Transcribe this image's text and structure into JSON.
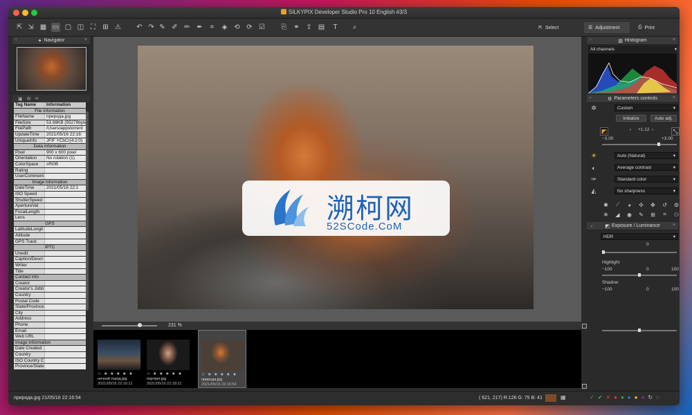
{
  "window": {
    "title": "SILKYPIX Developer Studio Pro 10 English   #3/3",
    "traffic_colors": [
      "#ff5f57",
      "#febc2e",
      "#28c840"
    ]
  },
  "toolbar": {
    "select_label": "Select",
    "adjustment_label": "Adjustment",
    "print_label": "Print"
  },
  "navigator": {
    "title": "Navigator"
  },
  "info": {
    "tag_header": "Tag Name",
    "info_header": "Information",
    "rows": [
      {
        "type": "section",
        "k": "File information"
      },
      {
        "k": "FileName",
        "v": "природа.jpg"
      },
      {
        "k": "FileSize",
        "v": "53.98KB (55279byte"
      },
      {
        "k": "FilePath",
        "v": "/Users/appstorrent"
      },
      {
        "k": "UpdateTime",
        "v": "2021/05/16 22:16:"
      },
      {
        "k": "UniqueInfo",
        "v": "JFIF YCbCr(4:2:0)"
      },
      {
        "type": "section",
        "k": "Data information"
      },
      {
        "k": "Pixel",
        "v": "900 x 600 pixel"
      },
      {
        "k": "Orientation",
        "v": "No rotation (1)"
      },
      {
        "k": "ColorSpace",
        "v": "sRGB"
      },
      {
        "k": "Rating",
        "v": ""
      },
      {
        "k": "UserComment",
        "v": ""
      },
      {
        "type": "section",
        "k": "Image information"
      },
      {
        "k": "DateTime",
        "v": "2021/05/16 22:1"
      },
      {
        "k": "ISO Speed",
        "v": ""
      },
      {
        "k": "ShutterSpeed",
        "v": ""
      },
      {
        "k": "ApertureVal",
        "v": ""
      },
      {
        "k": "FocalLength",
        "v": ""
      },
      {
        "k": "Lens",
        "v": ""
      },
      {
        "type": "section",
        "k": "GPS"
      },
      {
        "k": "LatitudeLongit",
        "v": ""
      },
      {
        "k": "Altitude",
        "v": ""
      },
      {
        "k": "GPS Track",
        "v": ""
      },
      {
        "type": "section",
        "k": "IPTC"
      },
      {
        "k": "Unedit",
        "v": ""
      },
      {
        "k": "Caption/Descr",
        "v": ""
      },
      {
        "k": "Writer",
        "v": ""
      },
      {
        "k": "Title",
        "v": ""
      },
      {
        "type": "section2",
        "k": "Contact info"
      },
      {
        "k": "Creator",
        "v": ""
      },
      {
        "k": "Creator's Jobti",
        "v": ""
      },
      {
        "k": "Country",
        "v": ""
      },
      {
        "k": "Postal Code",
        "v": ""
      },
      {
        "k": "State/Province",
        "v": ""
      },
      {
        "k": "City",
        "v": ""
      },
      {
        "k": "Address",
        "v": ""
      },
      {
        "k": "Phone",
        "v": ""
      },
      {
        "k": "Email",
        "v": ""
      },
      {
        "k": "Web URL",
        "v": ""
      },
      {
        "type": "section2",
        "k": "Image information"
      },
      {
        "k": "Date Created",
        "v": ""
      },
      {
        "k": "Country",
        "v": ""
      },
      {
        "k": "ISO Country C",
        "v": ""
      },
      {
        "k": "Province/State",
        "v": ""
      }
    ]
  },
  "watermark": {
    "cn": "溯柯网",
    "en": "52SCode.CoM"
  },
  "zoom": {
    "label": "231 %"
  },
  "filmstrip": [
    {
      "stars": "☆ ★ ★ ★ ★ ★",
      "name": "ночной город.jpg",
      "date": "2021/05/16 22:16:12"
    },
    {
      "stars": "☆ ★ ★ ★ ★ ★",
      "name": "портрет.jpg",
      "date": "2021/05/16 22:18:21"
    },
    {
      "stars": "☆ ★ ★ ★ ★ ★",
      "name": "природа.jpg",
      "date": "2021/05/16 22:16:54"
    }
  ],
  "histogram": {
    "title": "Histogram",
    "channel": "All channels"
  },
  "params": {
    "title": "Parameters controls",
    "taste": "Custom",
    "initialize_label": "Initialize",
    "auto_adj_label": "Auto adj.",
    "exposure_value": "+1.12",
    "exposure_min": "−3.00",
    "exposure_max": "+3.00",
    "wb": "Auto (Natural)",
    "contrast": "Average contrast",
    "color": "Standard color",
    "sharpness": "No sharpness"
  },
  "exposure_lum": {
    "title": "Exposure / Luminance",
    "hdr_label": "HDR",
    "hdr_value": "0",
    "highlight_label": "Highlight",
    "highlight_min": "−100",
    "highlight_max": "100",
    "highlight_value": "0",
    "shadow_label": "Shadow",
    "shadow_min": "−100",
    "shadow_max": "100",
    "shadow_value": "0"
  },
  "status": {
    "left": "природа.jpg 21/05/16 22:16:54",
    "coords": "( 621, 217) R:126 G: 75 B: 41",
    "swatch_color": "#7e4b29"
  }
}
